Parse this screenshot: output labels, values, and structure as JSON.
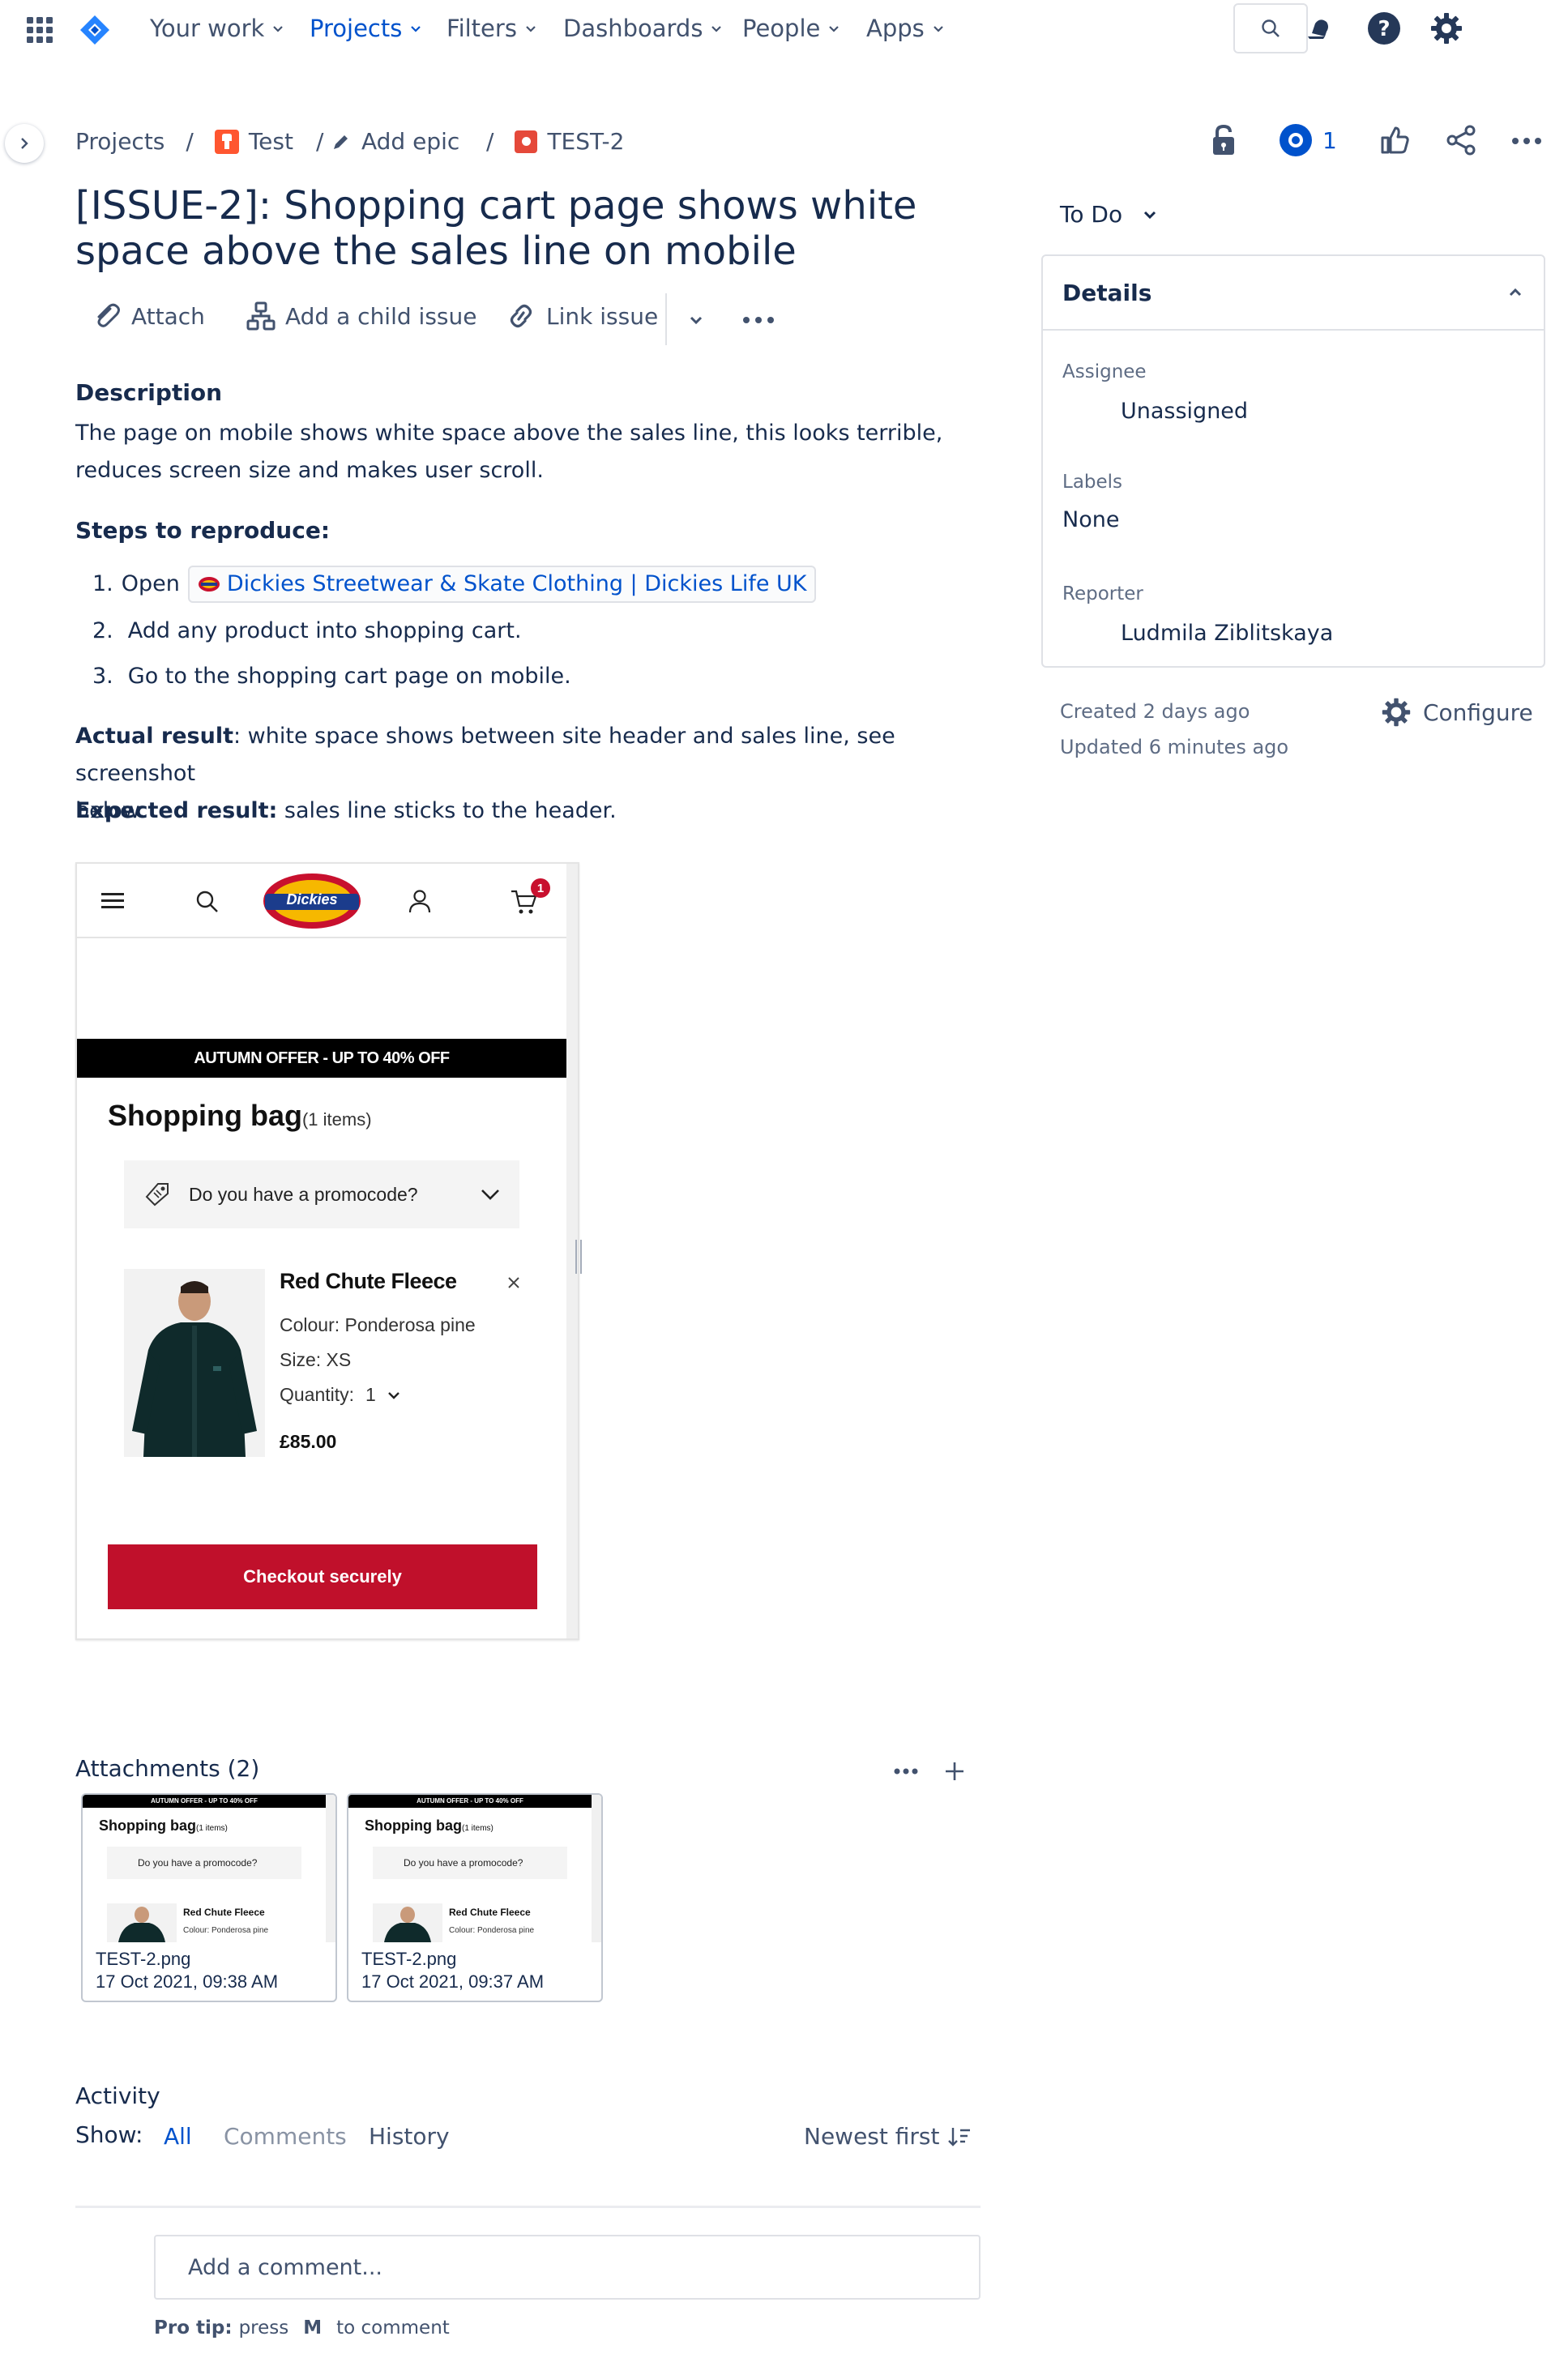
{
  "nav": {
    "your_work": "Your work",
    "projects": "Projects",
    "filters": "Filters",
    "dashboards": "Dashboards",
    "people": "People",
    "apps": "Apps"
  },
  "breadcrumb": {
    "projects": "Projects",
    "sep": "/",
    "project": "Test",
    "epic": "Add epic",
    "issue": "TEST-2"
  },
  "watchers": "1",
  "issue": {
    "title": "[ISSUE-2]: Shopping cart page shows white space above the sales line on mobile",
    "status": "To Do"
  },
  "toolbar": {
    "attach": "Attach",
    "child": "Add a child issue",
    "link": "Link issue"
  },
  "description": {
    "heading": "Description",
    "text": "The page on mobile shows white space above the sales line, this looks terrible, reduces screen size and makes user scroll.",
    "steps_heading": "Steps to reproduce:",
    "step1_num": "1.",
    "step1_prefix": "Open",
    "step1_link": "Dickies Streetwear & Skate Clothing | Dickies Life UK",
    "step2_num": "2.",
    "step2": "Add any product into shopping cart.",
    "step3_num": "3.",
    "step3": "Go to the shopping cart page on mobile.",
    "actual_label": "Actual result",
    "actual_text": ": white space shows between site header and sales line, see screenshot",
    "actual_text2": "below.",
    "expected_label": "Expected result:",
    "expected_text": "sales line sticks to the header."
  },
  "screenshot": {
    "cart_badge": "1",
    "logo": "Dickies",
    "offer": "AUTUMN OFFER - UP TO 40% OFF",
    "bag_title": "Shopping bag",
    "bag_count": "(1 items)",
    "promo": "Do you have a promocode?",
    "product": "Red Chute Fleece",
    "colour": "Colour: Ponderosa pine",
    "size": "Size: XS",
    "quantity_label": "Quantity:",
    "quantity": "1",
    "price": "£85.00",
    "checkout": "Checkout securely"
  },
  "details": {
    "heading": "Details",
    "assignee_label": "Assignee",
    "assignee": "Unassigned",
    "labels_label": "Labels",
    "labels": "None",
    "reporter_label": "Reporter",
    "reporter": "Ludmila Ziblitskaya",
    "created": "Created 2 days ago",
    "updated": "Updated 6 minutes ago",
    "configure": "Configure"
  },
  "attachments": {
    "heading": "Attachments (2)",
    "items": [
      {
        "name": "TEST-2.png",
        "date": "17 Oct 2021, 09:38 AM"
      },
      {
        "name": "TEST-2.png",
        "date": "17 Oct 2021, 09:37 AM"
      }
    ]
  },
  "activity": {
    "heading": "Activity",
    "show": "Show:",
    "all": "All",
    "comments": "Comments",
    "history": "History",
    "sort": "Newest first",
    "comment_placeholder": "Add a comment...",
    "protip_label": "Pro tip:",
    "protip_press": "press",
    "protip_key": "M",
    "protip_rest": "to comment"
  },
  "colors": {
    "brand_blue": "#0052CC",
    "text": "#172B4D",
    "subtle": "#42526E",
    "dickies_red": "#C8102E"
  }
}
